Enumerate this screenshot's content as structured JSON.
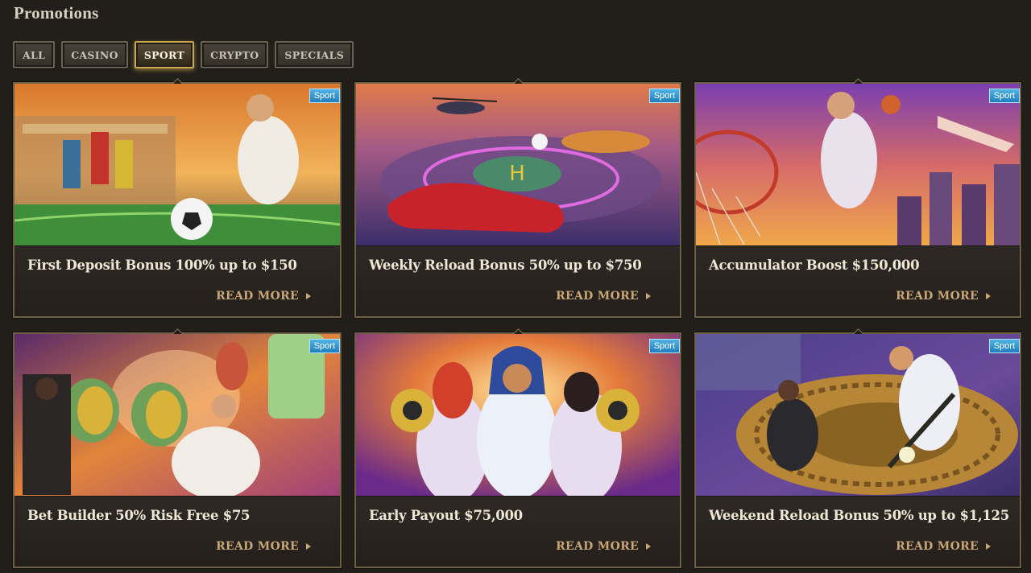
{
  "page": {
    "title": "Promotions"
  },
  "filters": [
    {
      "label": "ALL",
      "active": false
    },
    {
      "label": "CASINO",
      "active": false
    },
    {
      "label": "SPORT",
      "active": true
    },
    {
      "label": "CRYPTO",
      "active": false
    },
    {
      "label": "SPECIALS",
      "active": false
    }
  ],
  "promotions": [
    {
      "tag": "Sport",
      "title": "First Deposit Bonus 100% up to $150",
      "cta": "READ MORE",
      "scene": "soccer-kick"
    },
    {
      "tag": "Sport",
      "title": "Weekly Reload Bonus 50% up to $750",
      "cta": "READ MORE",
      "scene": "car-helipad"
    },
    {
      "tag": "Sport",
      "title": "Accumulator Boost $150,000",
      "cta": "READ MORE",
      "scene": "basketball-dunk"
    },
    {
      "tag": "Sport",
      "title": "Bet Builder 50% Risk Free $75",
      "cta": "READ MORE",
      "scene": "reels-machine"
    },
    {
      "tag": "Sport",
      "title": "Early Payout $75,000",
      "cta": "READ MORE",
      "scene": "golden-balls"
    },
    {
      "tag": "Sport",
      "title": "Weekend Reload Bonus 50% up to $1,125",
      "cta": "READ MORE",
      "scene": "baseball-swing"
    }
  ],
  "colors": {
    "accent": "#c9a84f",
    "tag": "#2a8fd0",
    "cta": "#c8a776",
    "background": "#221f1b"
  }
}
